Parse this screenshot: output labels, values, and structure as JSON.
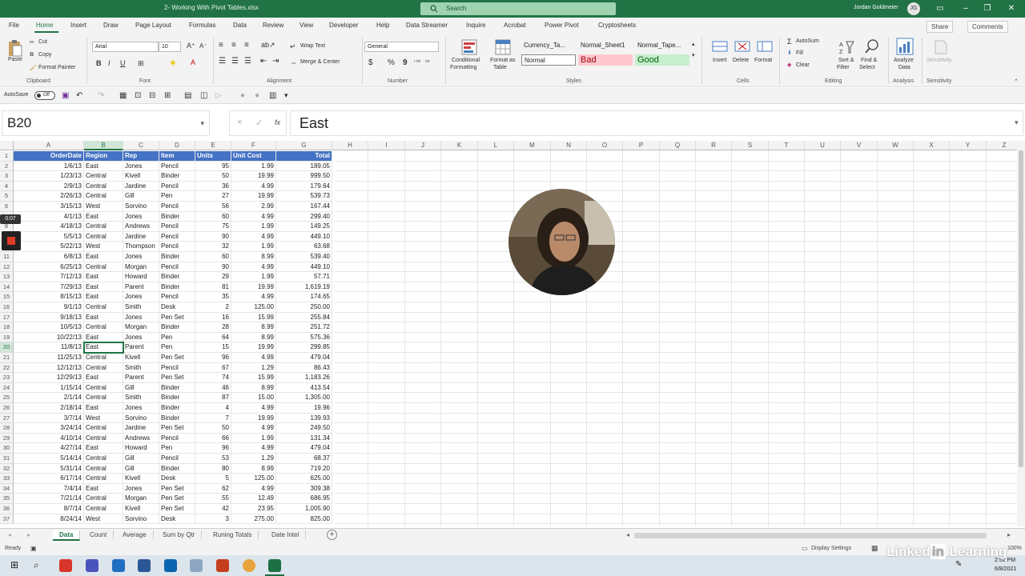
{
  "window": {
    "title": "2- Working With Pivot Tables.xlsx",
    "search_placeholder": "Search",
    "user_name": "Jordan Goldmeier",
    "user_initials": "JG"
  },
  "menu_tabs": [
    "File",
    "Home",
    "Insert",
    "Draw",
    "Page Layout",
    "Formulas",
    "Data",
    "Review",
    "View",
    "Developer",
    "Help",
    "Data Streamer",
    "Inquire",
    "Acrobat",
    "Power Pivot",
    "Cryptosheets"
  ],
  "menu_right": {
    "share": "Share",
    "comments": "Comments"
  },
  "ribbon": {
    "clipboard": {
      "paste": "Paste",
      "cut": "Cut",
      "copy": "Copy",
      "format_painter": "Format Painter",
      "label": "Clipboard"
    },
    "font": {
      "name": "Arial",
      "size": "10",
      "bold": "B",
      "italic": "I",
      "underline": "U",
      "label": "Font"
    },
    "alignment": {
      "wrap_text": "Wrap Text",
      "merge_center": "Merge & Center",
      "label": "Alignment"
    },
    "number": {
      "format": "General",
      "dollar": "$",
      "percent": "%",
      "comma": "9",
      "label": "Number"
    },
    "styles": {
      "conditional_formatting_1": "Conditional",
      "conditional_formatting_2": "Formatting",
      "format_as_table_1": "Format as",
      "format_as_table_2": "Table",
      "cell_styles": [
        "Currency_Ta...",
        "Normal_Sheet1",
        "Normal_Tape...",
        "Normal",
        "Bad",
        "Good"
      ],
      "label": "Styles"
    },
    "cells": {
      "insert": "Insert",
      "delete": "Delete",
      "format": "Format",
      "label": "Cells"
    },
    "editing": {
      "autosum": "AutoSum",
      "fill": "Fill",
      "clear": "Clear",
      "sort_filter_1": "Sort &",
      "sort_filter_2": "Filter",
      "find_select_1": "Find &",
      "find_select_2": "Select",
      "label": "Editing"
    },
    "analysis": {
      "analyze_1": "Analyze",
      "analyze_2": "Data",
      "label": "Analysis"
    },
    "sensitivity": {
      "button": "Sensitivity",
      "label": "Sensitivity"
    }
  },
  "qat": {
    "autosave": "AutoSave",
    "autosave_state": "Off"
  },
  "formula_bar": {
    "name_box": "B20",
    "cancel": "×",
    "enter": "✓",
    "fx": "fx",
    "value": "East"
  },
  "columns": [
    "A",
    "B",
    "C",
    "D",
    "E",
    "F",
    "G",
    "H",
    "I",
    "J",
    "K",
    "L",
    "M",
    "N",
    "O",
    "P",
    "Q",
    "R",
    "S",
    "T",
    "U",
    "V",
    "W",
    "X",
    "Y",
    "Z"
  ],
  "header_row": [
    "OrderDate",
    "Region",
    "Rep",
    "Item",
    "Units",
    "Unit Cost",
    "Total"
  ],
  "rows": [
    [
      "1/6/13",
      "East",
      "Jones",
      "Pencil",
      "95",
      "1.99",
      "189.05"
    ],
    [
      "1/23/13",
      "Central",
      "Kivell",
      "Binder",
      "50",
      "19.99",
      "999.50"
    ],
    [
      "2/9/13",
      "Central",
      "Jardine",
      "Pencil",
      "36",
      "4.99",
      "179.64"
    ],
    [
      "2/26/13",
      "Central",
      "Gill",
      "Pen",
      "27",
      "19.99",
      "539.73"
    ],
    [
      "3/15/13",
      "West",
      "Sorvino",
      "Pencil",
      "56",
      "2.99",
      "167.44"
    ],
    [
      "4/1/13",
      "East",
      "Jones",
      "Binder",
      "60",
      "4.99",
      "299.40"
    ],
    [
      "4/18/13",
      "Central",
      "Andrews",
      "Pencil",
      "75",
      "1.99",
      "149.25"
    ],
    [
      "5/5/13",
      "Central",
      "Jardine",
      "Pencil",
      "90",
      "4.99",
      "449.10"
    ],
    [
      "5/22/13",
      "West",
      "Thompson",
      "Pencil",
      "32",
      "1.99",
      "63.68"
    ],
    [
      "6/8/13",
      "East",
      "Jones",
      "Binder",
      "60",
      "8.99",
      "539.40"
    ],
    [
      "6/25/13",
      "Central",
      "Morgan",
      "Pencil",
      "90",
      "4.99",
      "449.10"
    ],
    [
      "7/12/13",
      "East",
      "Howard",
      "Binder",
      "29",
      "1.99",
      "57.71"
    ],
    [
      "7/29/13",
      "East",
      "Parent",
      "Binder",
      "81",
      "19.99",
      "1,619.19"
    ],
    [
      "8/15/13",
      "East",
      "Jones",
      "Pencil",
      "35",
      "4.99",
      "174.65"
    ],
    [
      "9/1/13",
      "Central",
      "Smith",
      "Desk",
      "2",
      "125.00",
      "250.00"
    ],
    [
      "9/18/13",
      "East",
      "Jones",
      "Pen Set",
      "16",
      "15.99",
      "255.84"
    ],
    [
      "10/5/13",
      "Central",
      "Morgan",
      "Binder",
      "28",
      "8.99",
      "251.72"
    ],
    [
      "10/22/13",
      "East",
      "Jones",
      "Pen",
      "64",
      "8.99",
      "575.36"
    ],
    [
      "11/8/13",
      "East",
      "Parent",
      "Pen",
      "15",
      "19.99",
      "299.85"
    ],
    [
      "11/25/13",
      "Central",
      "Kivell",
      "Pen Set",
      "96",
      "4.99",
      "479.04"
    ],
    [
      "12/12/13",
      "Central",
      "Smith",
      "Pencil",
      "67",
      "1.29",
      "86.43"
    ],
    [
      "12/29/13",
      "East",
      "Parent",
      "Pen Set",
      "74",
      "15.99",
      "1,183.26"
    ],
    [
      "1/15/14",
      "Central",
      "Gill",
      "Binder",
      "46",
      "8.99",
      "413.54"
    ],
    [
      "2/1/14",
      "Central",
      "Smith",
      "Binder",
      "87",
      "15.00",
      "1,305.00"
    ],
    [
      "2/18/14",
      "East",
      "Jones",
      "Binder",
      "4",
      "4.99",
      "19.96"
    ],
    [
      "3/7/14",
      "West",
      "Sorvino",
      "Binder",
      "7",
      "19.99",
      "139.93"
    ],
    [
      "3/24/14",
      "Central",
      "Jardine",
      "Pen Set",
      "50",
      "4.99",
      "249.50"
    ],
    [
      "4/10/14",
      "Central",
      "Andrews",
      "Pencil",
      "66",
      "1.99",
      "131.34"
    ],
    [
      "4/27/14",
      "East",
      "Howard",
      "Pen",
      "96",
      "4.99",
      "479.04"
    ],
    [
      "5/14/14",
      "Central",
      "Gill",
      "Pencil",
      "53",
      "1.29",
      "68.37"
    ],
    [
      "5/31/14",
      "Central",
      "Gill",
      "Binder",
      "80",
      "8.99",
      "719.20"
    ],
    [
      "6/17/14",
      "Central",
      "Kivell",
      "Desk",
      "5",
      "125.00",
      "625.00"
    ],
    [
      "7/4/14",
      "East",
      "Jones",
      "Pen Set",
      "62",
      "4.99",
      "309.38"
    ],
    [
      "7/21/14",
      "Central",
      "Morgan",
      "Pen Set",
      "55",
      "12.49",
      "686.95"
    ],
    [
      "8/7/14",
      "Central",
      "Kivell",
      "Pen Set",
      "42",
      "23.95",
      "1,005.90"
    ],
    [
      "8/24/14",
      "West",
      "Sorvino",
      "Desk",
      "3",
      "275.00",
      "825.00"
    ]
  ],
  "sheet_tabs": [
    "Data",
    "Count",
    "Average",
    "Sum by Qtr",
    "Runing Totals",
    "Date Intel"
  ],
  "active_sheet": "Data",
  "status": {
    "mode": "Ready",
    "display_settings": "Display Settings",
    "zoom": "100%"
  },
  "overlay": {
    "timer": "0:07",
    "watermark_1": "Linked",
    "watermark_2": "in",
    "watermark_3": " Learning"
  },
  "taskbar": {
    "time": "2:52 PM",
    "date": "6/8/2021"
  },
  "colors": {
    "excel_green": "#217346",
    "header_blue": "#4472c4",
    "bad_bg": "#ffc7ce",
    "bad_fg": "#9c0006",
    "good_bg": "#c6efce",
    "good_fg": "#006100"
  }
}
